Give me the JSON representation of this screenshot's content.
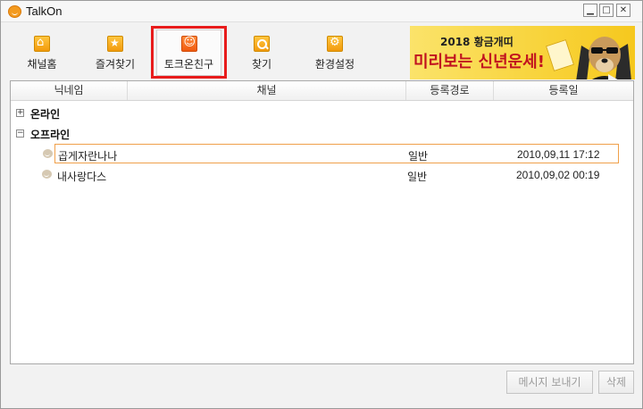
{
  "window": {
    "title": "TalkOn",
    "controls": {
      "minimize": "▁",
      "maximize": "□",
      "close": "✕"
    }
  },
  "toolbar": {
    "items": [
      {
        "label": "채널홈",
        "icon": "home-icon"
      },
      {
        "label": "즐겨찾기",
        "icon": "star-icon"
      },
      {
        "label": "토크온친구",
        "icon": "smiley-icon",
        "selected": true
      },
      {
        "label": "찾기",
        "icon": "search-icon"
      },
      {
        "label": "환경설정",
        "icon": "gear-icon"
      }
    ]
  },
  "banner": {
    "line1": "2018 황금개띠",
    "line2": "미리보는 신년운세!"
  },
  "list": {
    "columns": [
      "닉네임",
      "채널",
      "등록경로",
      "등록일"
    ],
    "groups": [
      {
        "name": "온라인",
        "toggle": "+",
        "expanded": false,
        "friends": []
      },
      {
        "name": "오프라인",
        "toggle": "−",
        "expanded": true,
        "friends": [
          {
            "nickname": "곱게자란나나",
            "channel": "",
            "route": "일반",
            "date": "2010,09,11 17:12",
            "selected": true
          },
          {
            "nickname": "내사랑다스",
            "channel": "",
            "route": "일반",
            "date": "2010,09,02 00:19",
            "selected": false
          }
        ]
      }
    ]
  },
  "buttons": {
    "send_message": "메시지 보내기",
    "delete": "삭제"
  },
  "colors": {
    "accent_orange": "#f39a1e",
    "highlight_red": "#e81c1c",
    "selection_border": "#f0a04a",
    "banner_yellow": "#f8d33a",
    "banner_text_red": "#c1121f"
  }
}
